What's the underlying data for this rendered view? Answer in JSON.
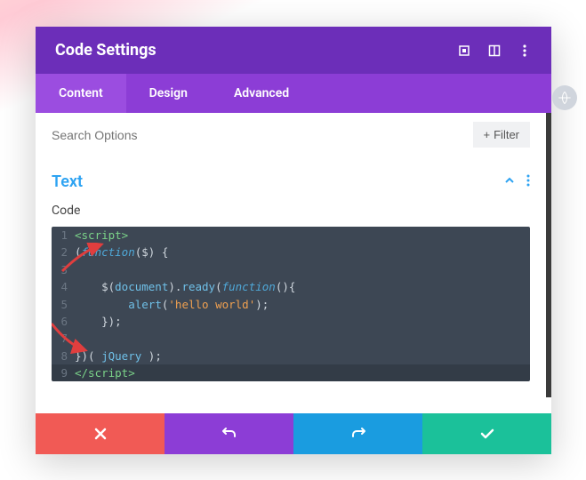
{
  "header": {
    "title": "Code Settings"
  },
  "tabs": [
    {
      "label": "Content",
      "active": true
    },
    {
      "label": "Design",
      "active": false
    },
    {
      "label": "Advanced",
      "active": false
    }
  ],
  "search": {
    "placeholder": "Search Options",
    "filter_label": "Filter"
  },
  "section": {
    "title": "Text",
    "field_label": "Code"
  },
  "code": {
    "lines": [
      {
        "n": 1,
        "tokens": [
          [
            "tag",
            "<script>"
          ]
        ]
      },
      {
        "n": 2,
        "tokens": [
          [
            "punc",
            "("
          ],
          [
            "key",
            "function"
          ],
          [
            "punc",
            "($) {"
          ]
        ]
      },
      {
        "n": 3,
        "tokens": []
      },
      {
        "n": 4,
        "tokens": [
          [
            "punc",
            "    $("
          ],
          [
            "var",
            "document"
          ],
          [
            "punc",
            ")."
          ],
          [
            "var",
            "ready"
          ],
          [
            "punc",
            "("
          ],
          [
            "key",
            "function"
          ],
          [
            "punc",
            "(){"
          ]
        ]
      },
      {
        "n": 5,
        "tokens": [
          [
            "punc",
            "        "
          ],
          [
            "var",
            "alert"
          ],
          [
            "punc",
            "("
          ],
          [
            "str",
            "'hello world'"
          ],
          [
            "punc",
            ");"
          ]
        ]
      },
      {
        "n": 6,
        "tokens": [
          [
            "punc",
            "    });"
          ]
        ]
      },
      {
        "n": 7,
        "tokens": []
      },
      {
        "n": 8,
        "tokens": [
          [
            "punc",
            "})( "
          ],
          [
            "var",
            "jQuery"
          ],
          [
            "punc",
            " );"
          ]
        ]
      },
      {
        "n": 9,
        "tokens": [
          [
            "tag",
            "</script>"
          ]
        ],
        "hl": true
      }
    ]
  },
  "colors": {
    "header_bg": "#6c2eb9",
    "tabs_bg": "#8c3dd6",
    "accent": "#2ea3f2",
    "cancel": "#f15a55",
    "undo": "#8c3dd6",
    "redo": "#1a9ce0",
    "save": "#1bc19a"
  }
}
